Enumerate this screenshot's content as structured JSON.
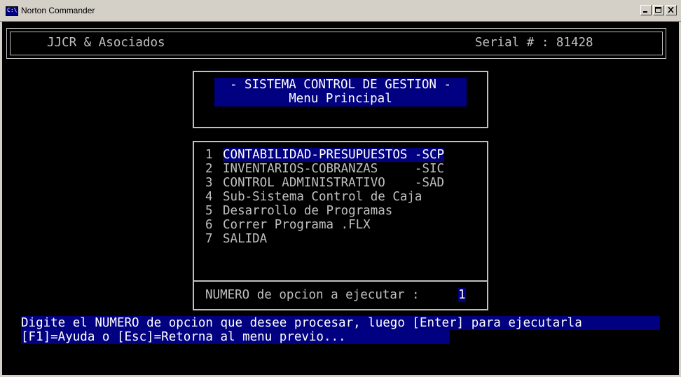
{
  "window": {
    "title": "Norton Commander"
  },
  "header": {
    "company": "JJCR & Asociados",
    "serial": "Serial # : 81428"
  },
  "title_box": {
    "line1": "- SISTEMA CONTROL DE GESTION -",
    "line2": "Menu Principal"
  },
  "menu": {
    "items": [
      {
        "num": "1",
        "label": "CONTABILIDAD-PRESUPUESTOS -SCP"
      },
      {
        "num": "2",
        "label": "INVENTARIOS-COBRANZAS     -SIC"
      },
      {
        "num": "3",
        "label": "CONTROL ADMINISTRATIVO    -SAD"
      },
      {
        "num": "4",
        "label": "Sub-Sistema Control de Caja"
      },
      {
        "num": "5",
        "label": "Desarrollo de Programas"
      },
      {
        "num": "6",
        "label": "Correr Programa .FLX"
      },
      {
        "num": "7",
        "label": "SALIDA"
      }
    ],
    "selected_index": 0
  },
  "prompt": {
    "label": "NUMERO de opcion a ejecutar :",
    "value": "1"
  },
  "help": {
    "line1": "Digite el NUMERO de opcion que desee procesar, luego [Enter] para ejecutarla",
    "line2": "[F1]=Ayuda o [Esc]=Retorna al menu previo..."
  },
  "colors": {
    "console_bg": "#000000",
    "console_fg": "#c0c0c0",
    "highlight_bg": "#000080",
    "highlight_fg": "#ffffff"
  }
}
